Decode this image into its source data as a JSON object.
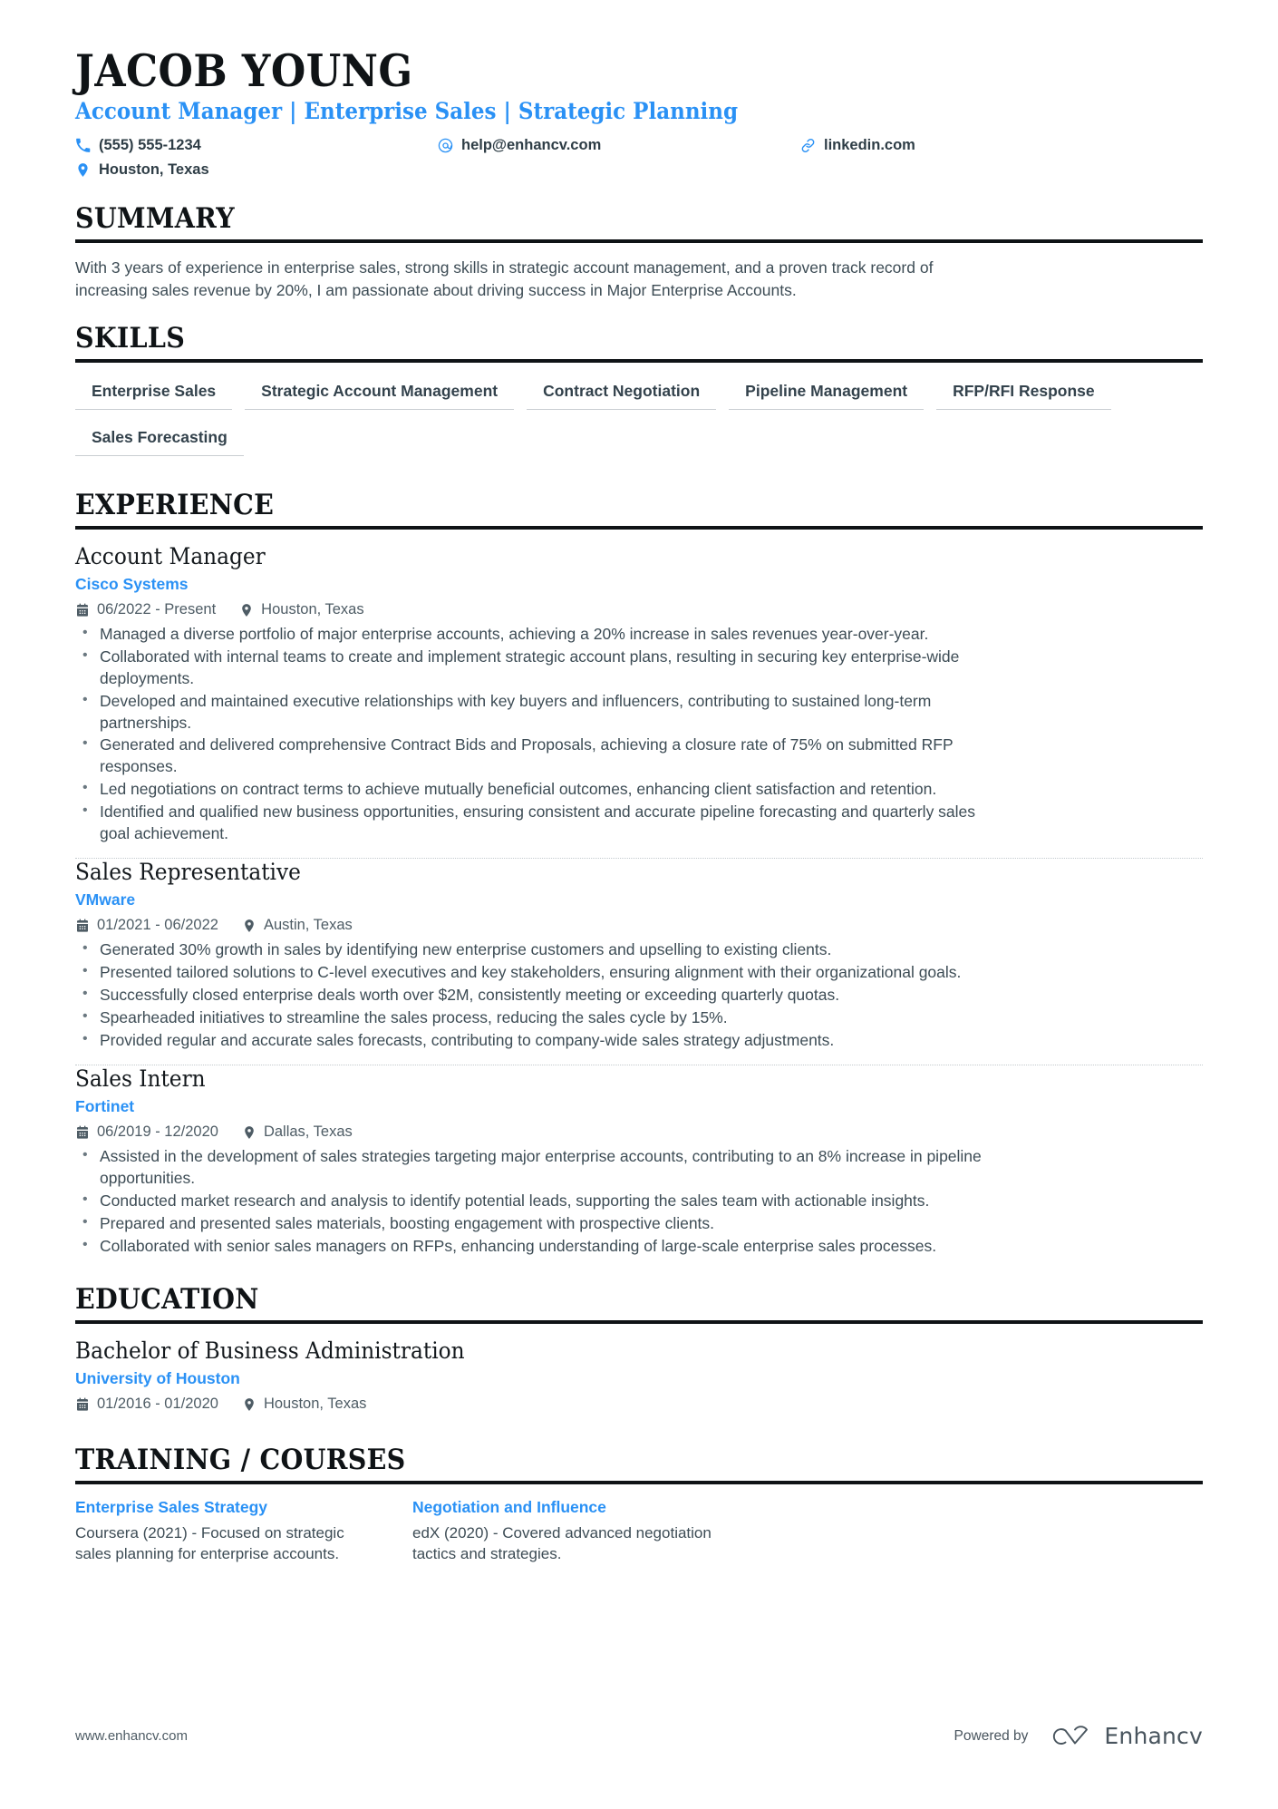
{
  "header": {
    "name": "JACOB YOUNG",
    "headline": "Account Manager | Enterprise Sales | Strategic Planning",
    "contacts": [
      {
        "icon": "phone-icon",
        "text": "(555) 555-1234"
      },
      {
        "icon": "email-icon",
        "text": "help@enhancv.com"
      },
      {
        "icon": "link-icon",
        "text": "linkedin.com"
      },
      {
        "icon": "location-icon",
        "text": "Houston, Texas"
      }
    ]
  },
  "summary": {
    "title": "SUMMARY",
    "text": "With 3 years of experience in enterprise sales, strong skills in strategic account management, and a proven track record of increasing sales revenue by 20%, I am passionate about driving success in Major Enterprise Accounts."
  },
  "skills": {
    "title": "SKILLS",
    "items": [
      "Enterprise Sales",
      "Strategic Account Management",
      "Contract Negotiation",
      "Pipeline Management",
      "RFP/RFI Response",
      "Sales Forecasting"
    ]
  },
  "experience": {
    "title": "EXPERIENCE",
    "entries": [
      {
        "job_title": "Account Manager",
        "company": "Cisco Systems",
        "dates": "06/2022 - Present",
        "location": "Houston, Texas",
        "bullets": [
          "Managed a diverse portfolio of major enterprise accounts, achieving a 20% increase in sales revenues year-over-year.",
          "Collaborated with internal teams to create and implement strategic account plans, resulting in securing key enterprise-wide deployments.",
          "Developed and maintained executive relationships with key buyers and influencers, contributing to sustained long-term partnerships.",
          "Generated and delivered comprehensive Contract Bids and Proposals, achieving a closure rate of 75% on submitted RFP responses.",
          "Led negotiations on contract terms to achieve mutually beneficial outcomes, enhancing client satisfaction and retention.",
          "Identified and qualified new business opportunities, ensuring consistent and accurate pipeline forecasting and quarterly sales goal achievement."
        ]
      },
      {
        "job_title": "Sales Representative",
        "company": "VMware",
        "dates": "01/2021 - 06/2022",
        "location": "Austin, Texas",
        "bullets": [
          "Generated 30% growth in sales by identifying new enterprise customers and upselling to existing clients.",
          "Presented tailored solutions to C-level executives and key stakeholders, ensuring alignment with their organizational goals.",
          "Successfully closed enterprise deals worth over $2M, consistently meeting or exceeding quarterly quotas.",
          "Spearheaded initiatives to streamline the sales process, reducing the sales cycle by 15%.",
          "Provided regular and accurate sales forecasts, contributing to company-wide sales strategy adjustments."
        ]
      },
      {
        "job_title": "Sales Intern",
        "company": "Fortinet",
        "dates": "06/2019 - 12/2020",
        "location": "Dallas, Texas",
        "bullets": [
          "Assisted in the development of sales strategies targeting major enterprise accounts, contributing to an 8% increase in pipeline opportunities.",
          "Conducted market research and analysis to identify potential leads, supporting the sales team with actionable insights.",
          "Prepared and presented sales materials, boosting engagement with prospective clients.",
          "Collaborated with senior sales managers on RFPs, enhancing understanding of large-scale enterprise sales processes."
        ]
      }
    ]
  },
  "education": {
    "title": "EDUCATION",
    "entries": [
      {
        "degree": "Bachelor of Business Administration",
        "school": "University of Houston",
        "dates": "01/2016 - 01/2020",
        "location": "Houston, Texas"
      }
    ]
  },
  "training": {
    "title": "TRAINING / COURSES",
    "courses": [
      {
        "name": "Enterprise Sales Strategy",
        "description": "Coursera (2021) - Focused on strategic sales planning for enterprise accounts."
      },
      {
        "name": "Negotiation and Influence",
        "description": "edX (2020) - Covered advanced negotiation tactics and strategies."
      }
    ]
  },
  "footer": {
    "url": "www.enhancv.com",
    "powered_by": "Powered by",
    "brand": "Enhancv"
  },
  "colors": {
    "accent": "#2a91f5",
    "text": "#3d4c55",
    "heading": "#0f1316"
  }
}
